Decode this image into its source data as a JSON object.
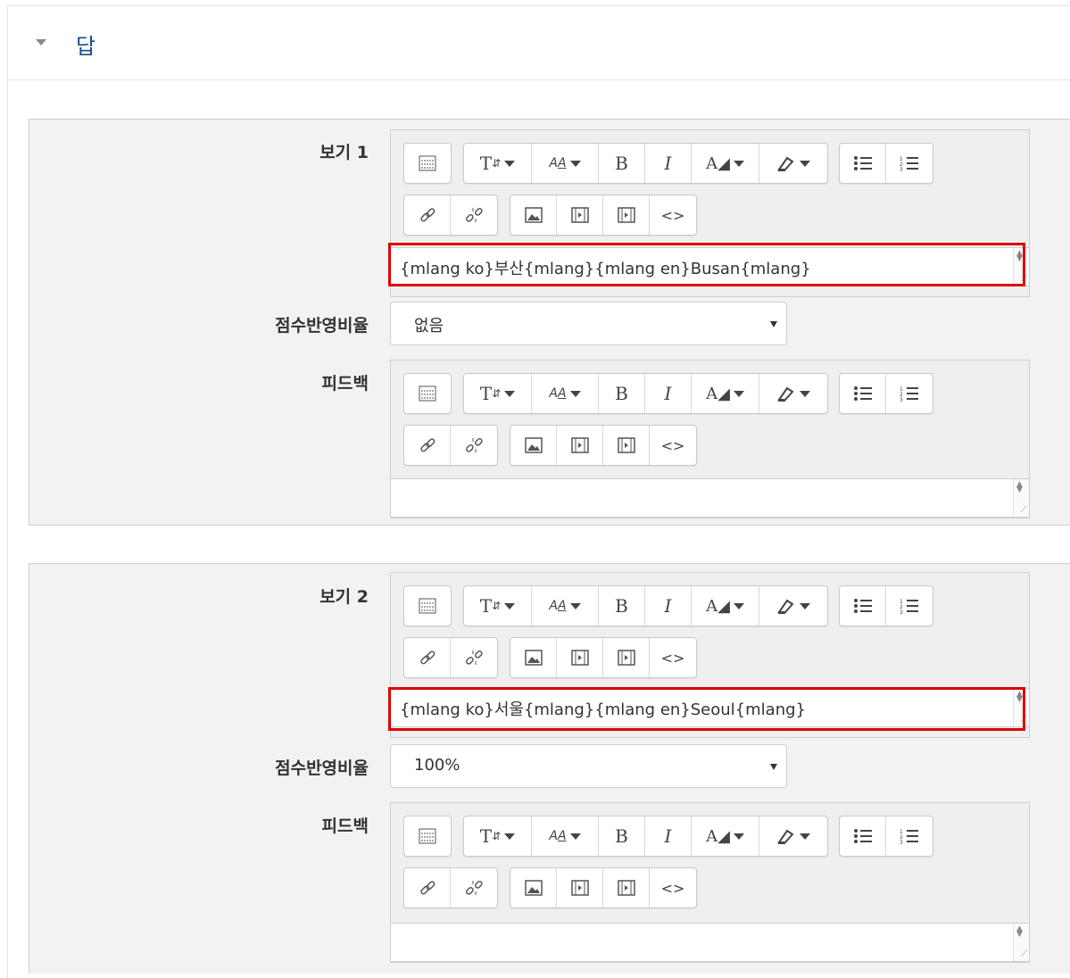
{
  "section": {
    "title": "답"
  },
  "choices": [
    {
      "label": "보기 1",
      "answer_text": "{mlang ko}부산{mlang}{mlang en}Busan{mlang}",
      "grade_label": "점수반영비율",
      "grade_value": "없음",
      "feedback_label": "피드백",
      "feedback_text": ""
    },
    {
      "label": "보기 2",
      "answer_text": "{mlang ko}서울{mlang}{mlang en}Seoul{mlang}",
      "grade_label": "점수반영비율",
      "grade_value": "100%",
      "feedback_label": "피드백",
      "feedback_text": ""
    }
  ],
  "toolbar": {
    "style_btn": "T",
    "bold": "B",
    "italic": "I",
    "code": "<>",
    "icons": [
      "toolbar-toggle-icon",
      "paragraph-styles-icon",
      "font-size-icon",
      "bold-icon",
      "italic-icon",
      "font-color-icon",
      "background-color-icon",
      "unordered-list-icon",
      "ordered-list-icon",
      "link-icon",
      "unlink-icon",
      "image-icon",
      "media-icon",
      "recorder-icon",
      "html-icon"
    ]
  },
  "colors": {
    "highlight": "#e00000",
    "title": "#1a4b8a"
  }
}
